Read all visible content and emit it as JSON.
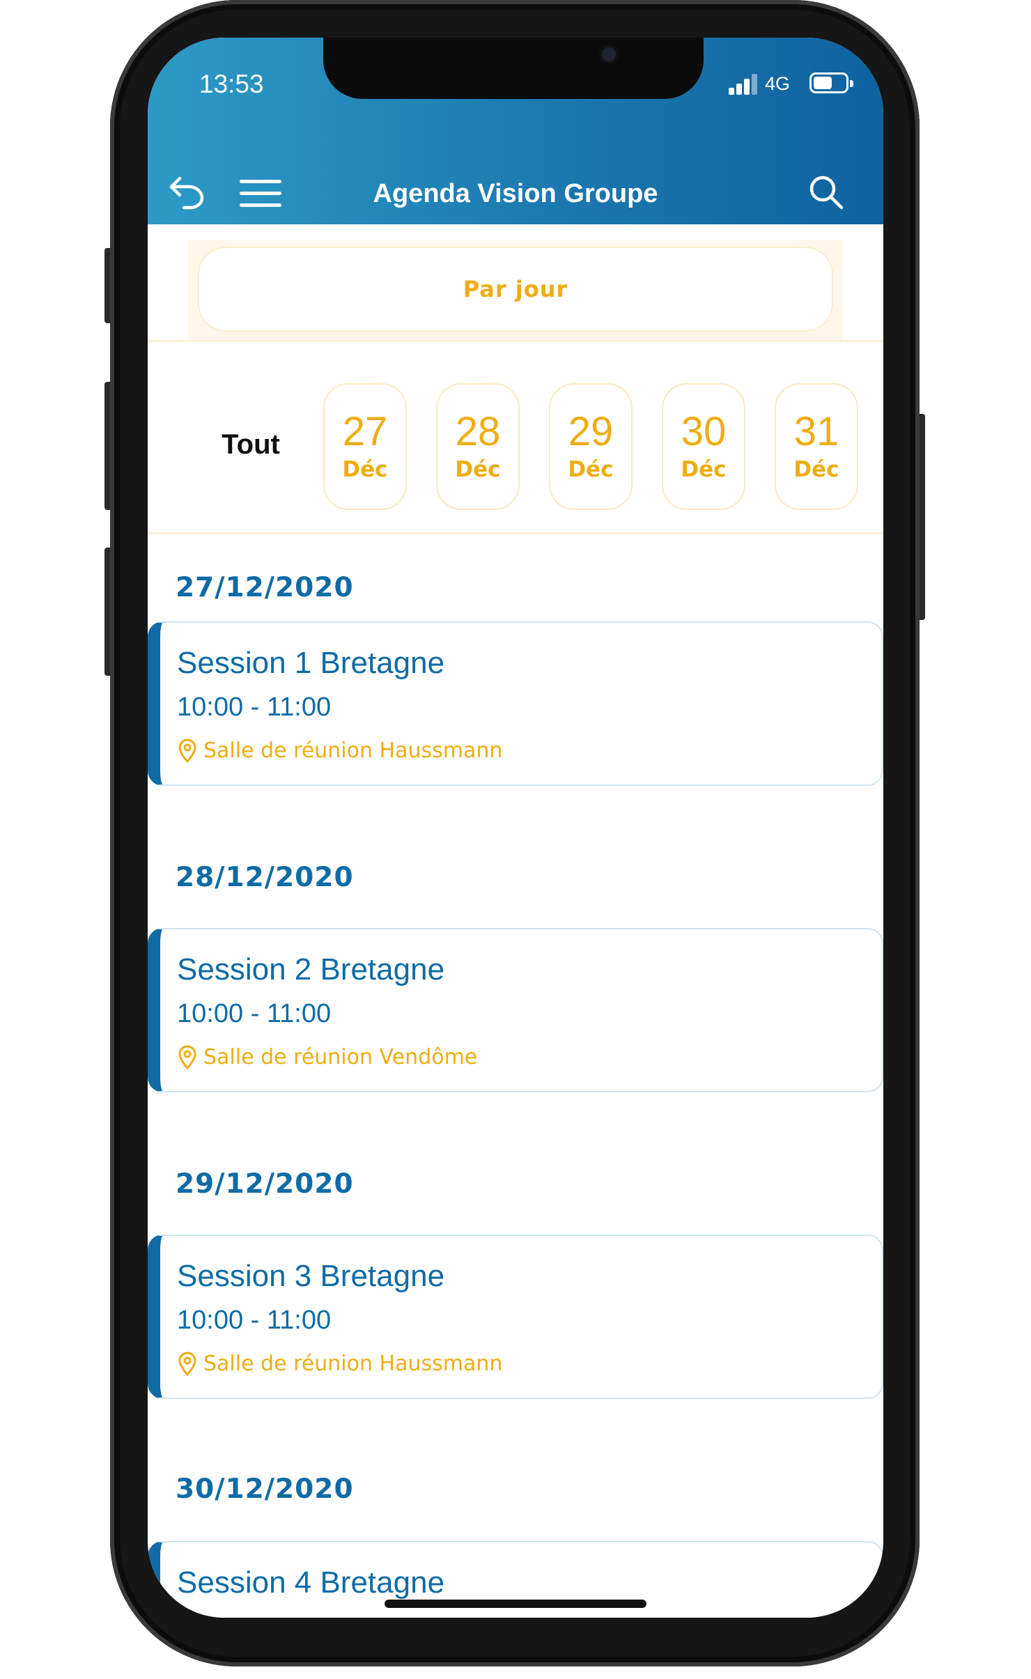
{
  "status_bar": {
    "time": "13:53",
    "network": "4G"
  },
  "header": {
    "title": "Agenda Vision Groupe",
    "back_icon": "back-arrow-icon",
    "menu_icon": "hamburger-menu-icon",
    "search_icon": "search-icon"
  },
  "view_mode": {
    "label": "Par jour"
  },
  "date_filter": {
    "all_label": "Tout",
    "dates": [
      {
        "day": "27",
        "month": "Déc"
      },
      {
        "day": "28",
        "month": "Déc"
      },
      {
        "day": "29",
        "month": "Déc"
      },
      {
        "day": "30",
        "month": "Déc"
      },
      {
        "day": "31",
        "month": "Déc"
      }
    ]
  },
  "agenda": {
    "groups": [
      {
        "date": "27/12/2020",
        "event": {
          "title": "Session 1 Bretagne",
          "time": "10:00 - 11:00",
          "location": "Salle de réunion Haussmann"
        }
      },
      {
        "date": "28/12/2020",
        "event": {
          "title": "Session 2 Bretagne",
          "time": "10:00 - 11:00",
          "location": "Salle de réunion Vendôme"
        }
      },
      {
        "date": "29/12/2020",
        "event": {
          "title": "Session 3 Bretagne",
          "time": "10:00 - 11:00",
          "location": "Salle de réunion Haussmann"
        }
      },
      {
        "date": "30/12/2020",
        "event": {
          "title": "Session 4 Bretagne"
        }
      }
    ]
  },
  "colors": {
    "primary": "#0f6ba6",
    "accent": "#efad12",
    "header_gradient_start": "#2d9ac6",
    "header_gradient_end": "#0f62a0"
  }
}
